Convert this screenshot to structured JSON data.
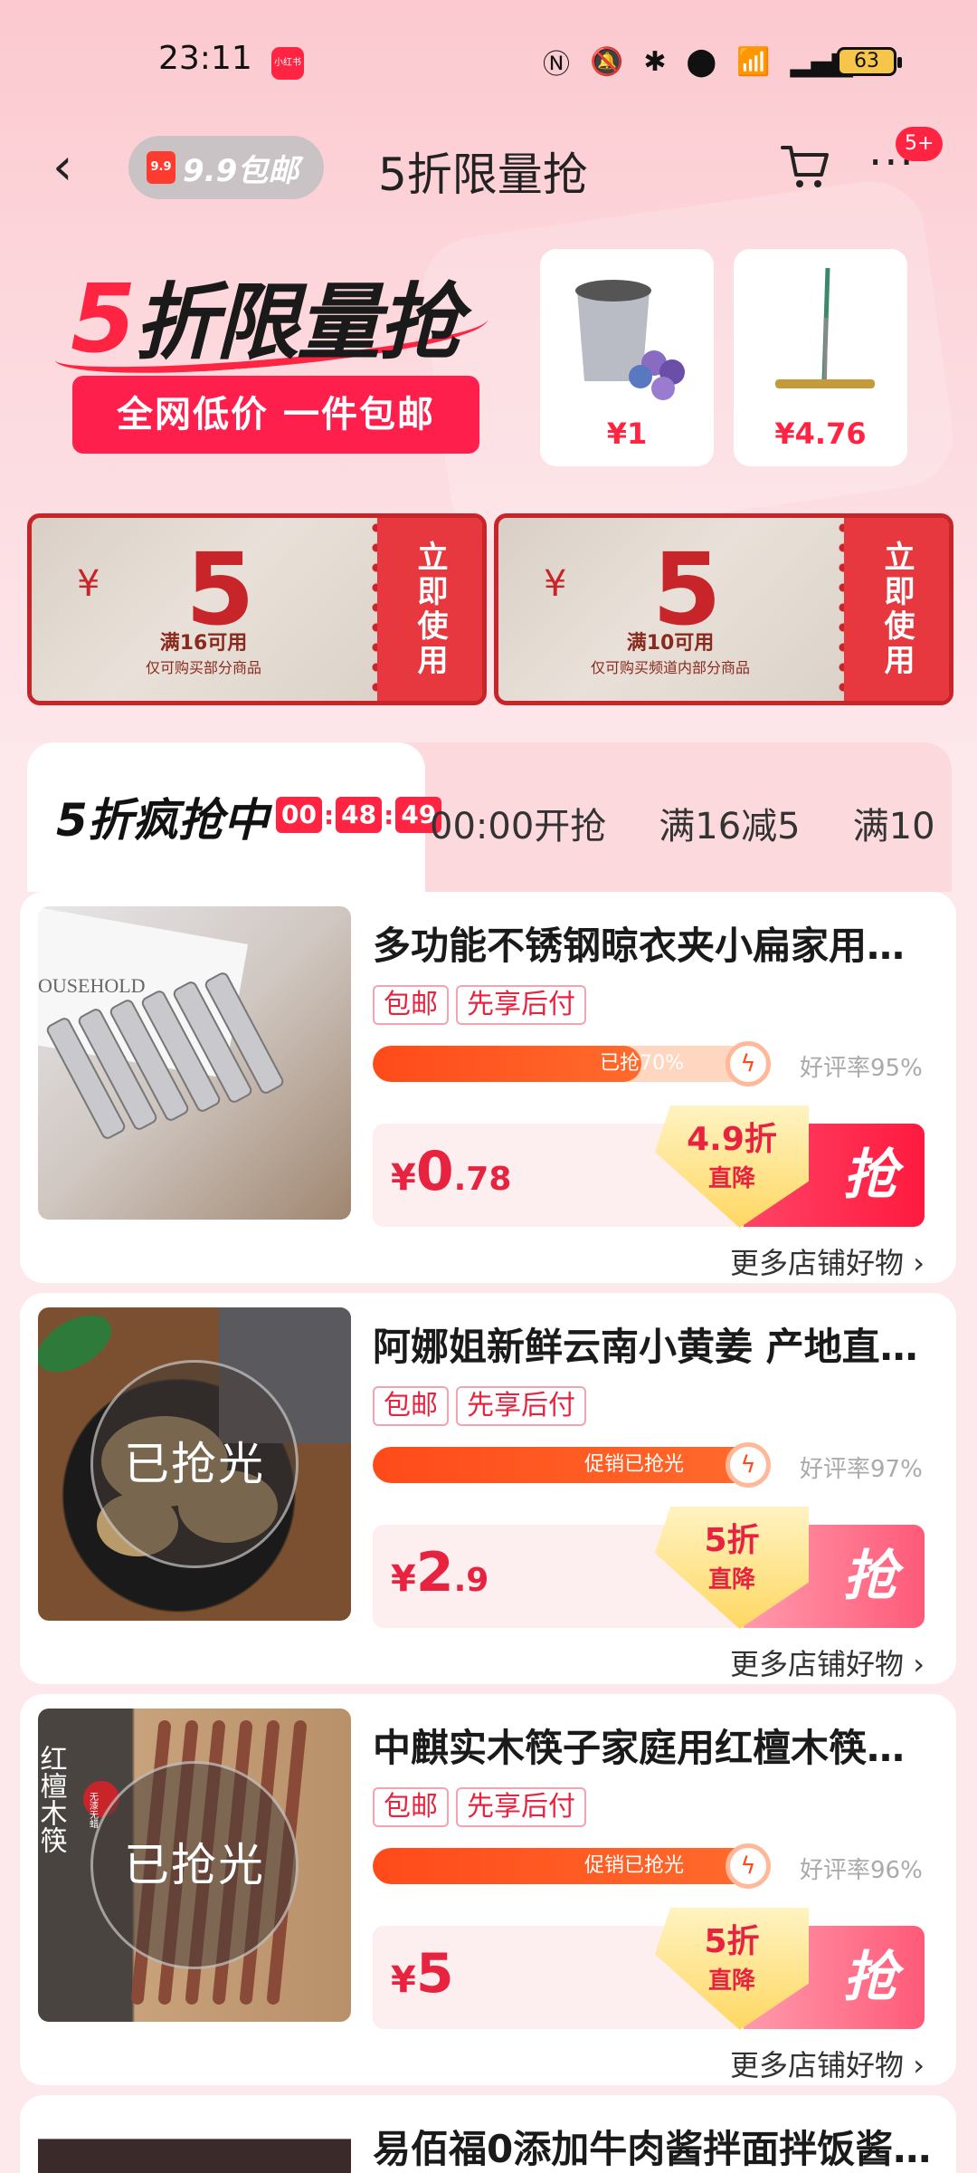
{
  "status": {
    "time": "23:11",
    "app_icon": "小红书",
    "battery": "63"
  },
  "header": {
    "pill_label": "9.9包邮",
    "pill_badge": "9.9",
    "title": "5折限量抢",
    "more_badge": "5+"
  },
  "banner": {
    "title_prefix": "5",
    "title_rest": "折限量抢",
    "button": "全网低价 一件包邮",
    "featured": [
      {
        "price": "¥1"
      },
      {
        "price": "¥4.76"
      }
    ]
  },
  "coupons": [
    {
      "currency": "¥",
      "amount": "5",
      "condition": "满16可用",
      "scope": "仅可购买部分商品",
      "action": "立即使用"
    },
    {
      "currency": "¥",
      "amount": "5",
      "condition": "满10可用",
      "scope": "仅可购买频道内部分商品",
      "action": "立即使用"
    }
  ],
  "section": {
    "title": "5折疯抢中",
    "timer": [
      "00",
      "48",
      "49"
    ],
    "tabs": [
      "00:00开抢",
      "满16减5",
      "满10"
    ]
  },
  "products": [
    {
      "name": "多功能不锈钢晾衣夹小扁家用…",
      "tags": [
        "包邮",
        "先享后付"
      ],
      "progress_text": "已抢70%",
      "progress": 0.7,
      "rating": "好评率95%",
      "price_yen": "¥",
      "price_int": "0",
      "price_dec": ".78",
      "discount": "4.9折",
      "discount_sub": "直降",
      "grab": "抢",
      "more": "更多店铺好物 ›",
      "sold_out": ""
    },
    {
      "name": "阿娜姐新鲜云南小黄姜 产地直…",
      "tags": [
        "包邮",
        "先享后付"
      ],
      "progress_text": "促销已抢光",
      "progress": 1.0,
      "rating": "好评率97%",
      "price_yen": "¥",
      "price_int": "2",
      "price_dec": ".9",
      "discount": "5折",
      "discount_sub": "直降",
      "grab": "抢",
      "more": "更多店铺好物 ›",
      "sold_out": "已抢光"
    },
    {
      "name": "中麒实木筷子家庭用红檀木筷…",
      "tags": [
        "包邮",
        "先享后付"
      ],
      "progress_text": "促销已抢光",
      "progress": 1.0,
      "rating": "好评率96%",
      "price_yen": "¥",
      "price_int": "5",
      "price_dec": "",
      "discount": "5折",
      "discount_sub": "直降",
      "grab": "抢",
      "more": "更多店铺好物 ›",
      "sold_out": "已抢光",
      "image_text": "红檀木筷",
      "image_stamp": "无漆无蜡"
    },
    {
      "name": "易佰福0添加牛肉酱拌面拌饭酱…"
    }
  ],
  "image_labels": {
    "product1": "OUSEHOLD"
  },
  "colors": {
    "accent": "#ff2442",
    "coupon_red": "#c8252b",
    "progress": "#ff4a1a"
  }
}
